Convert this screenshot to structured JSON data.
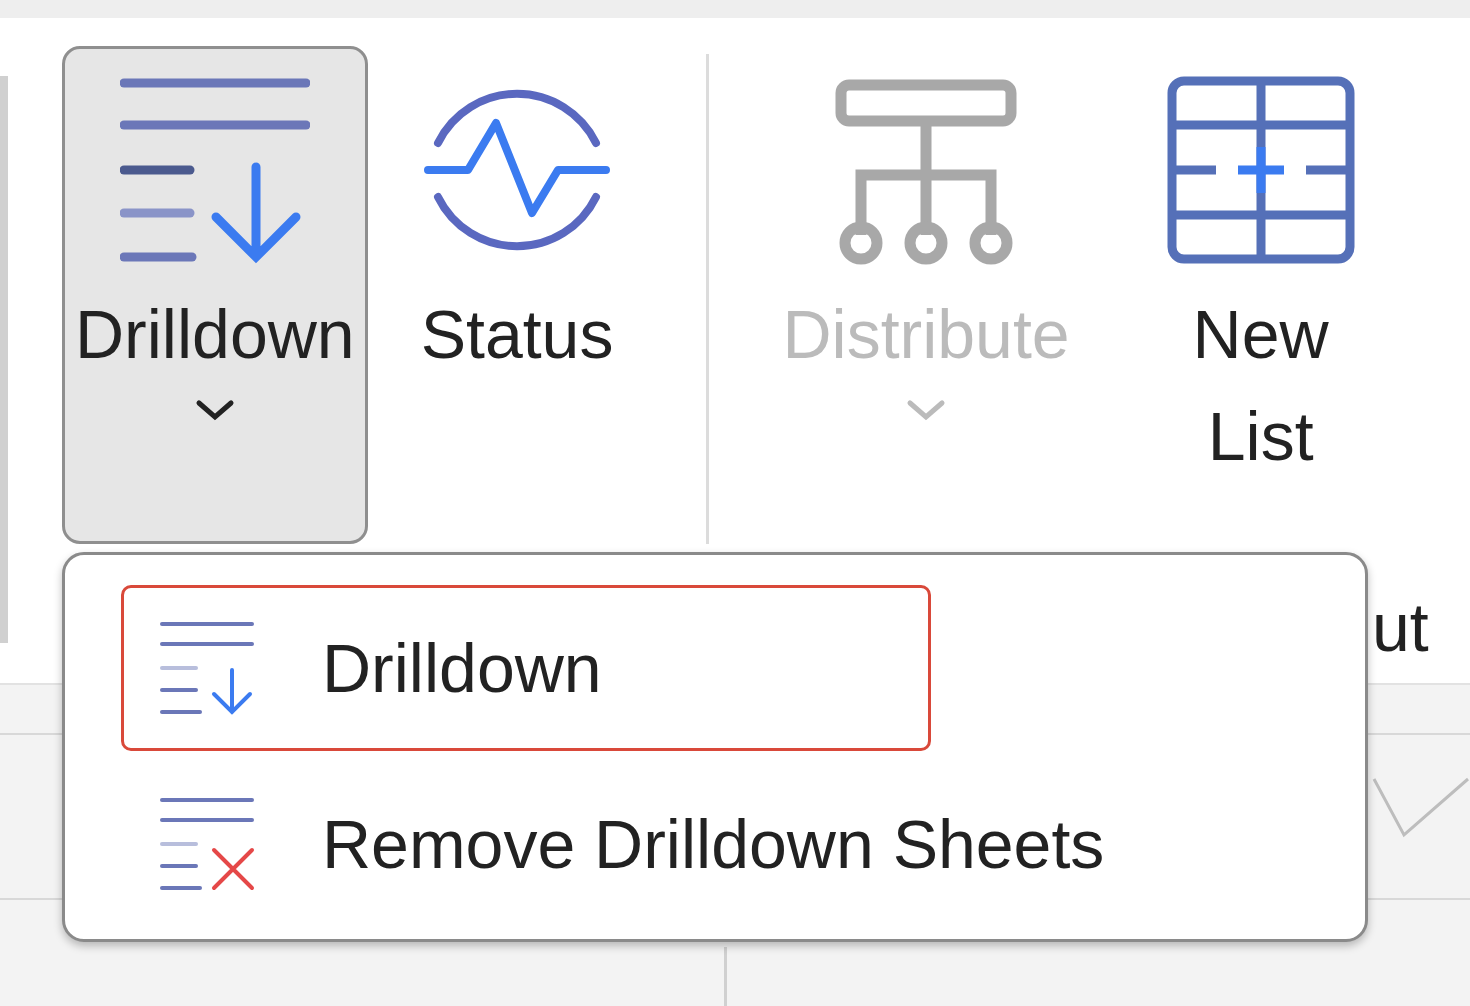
{
  "ribbon": {
    "buttons": [
      {
        "kind": "dropdown",
        "label": "Drilldown",
        "pressed": true,
        "disabled": false
      },
      {
        "kind": "button",
        "label": "Status",
        "pressed": false,
        "disabled": false
      },
      {
        "kind": "dropdown",
        "label": "Distribute",
        "pressed": false,
        "disabled": true
      },
      {
        "kind": "button",
        "label": "New List",
        "pressed": false,
        "disabled": false
      }
    ],
    "group_label": "ut"
  },
  "menu": {
    "items": [
      {
        "label": "Drilldown",
        "selected": true
      },
      {
        "label": "Remove Drilldown Sheets",
        "selected": false
      }
    ]
  }
}
